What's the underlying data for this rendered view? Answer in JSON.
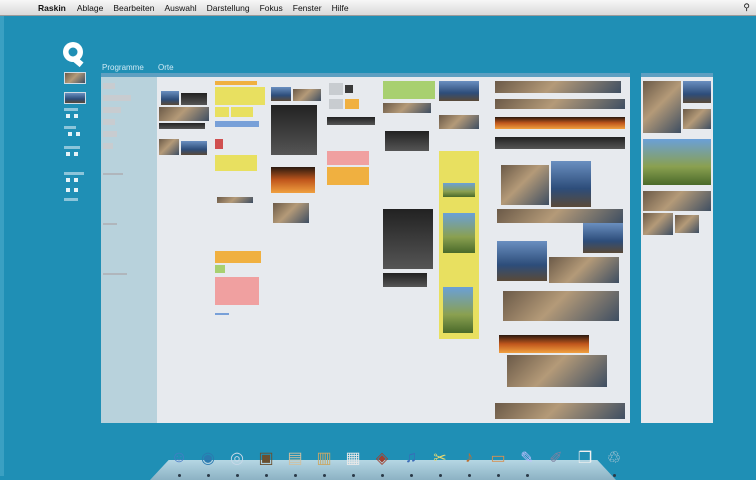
{
  "menubar": {
    "apple": "",
    "app_name": "Raskin",
    "items": [
      "Ablage",
      "Bearbeiten",
      "Auswahl",
      "Darstellung",
      "Fokus",
      "Fenster",
      "Hilfe"
    ],
    "spotlight": "⚲"
  },
  "sections": {
    "programs": "Programme",
    "places": "Orte"
  },
  "colors": {
    "desktop": "#1f8fb5",
    "column": "#e7eaee",
    "program_column": "#b8d2dc"
  },
  "dock": {
    "icons": [
      "finder-icon",
      "raskin-icon",
      "safari-icon",
      "iphoto-icon",
      "preview-icon",
      "address-book-icon",
      "ical-icon",
      "photo-booth-icon",
      "itunes-icon",
      "scissors-app-icon",
      "garageband-icon",
      "keynote-icon",
      "textedit-icon",
      "script-editor-icon",
      "documents-stack-icon",
      "trash-icon"
    ]
  }
}
